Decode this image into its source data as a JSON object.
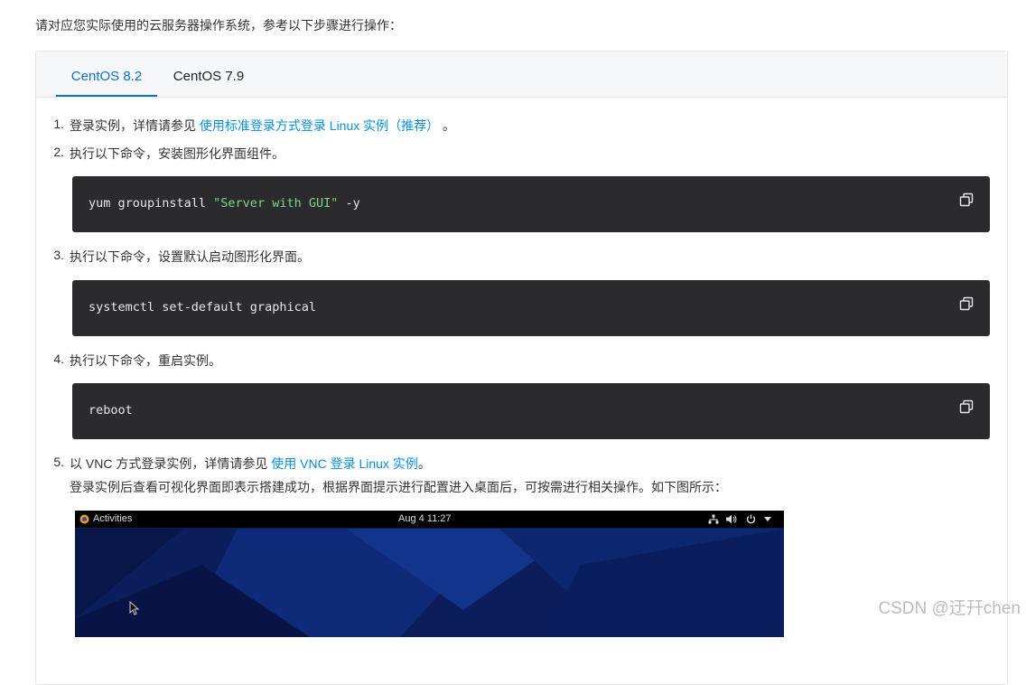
{
  "intro": "请对应您实际使用的云服务器操作系统，参考以下步骤进行操作：",
  "tabs": [
    {
      "label": "CentOS 8.2",
      "active": true
    },
    {
      "label": "CentOS 7.9",
      "active": false
    }
  ],
  "steps": {
    "s1": {
      "num": "1.",
      "pre": "登录实例，详情请参见 ",
      "link": "使用标准登录方式登录 Linux 实例（推荐）",
      "post": " 。"
    },
    "s2": {
      "num": "2.",
      "text": "执行以下命令，安装图形化界面组件。"
    },
    "s3": {
      "num": "3.",
      "text": "执行以下命令，设置默认启动图形化界面。"
    },
    "s4": {
      "num": "4.",
      "text": "执行以下命令，重启实例。"
    },
    "s5": {
      "num": "5.",
      "pre": "以 VNC 方式登录实例，详情请参见 ",
      "link": "使用 VNC 登录 Linux 实例",
      "post": "。",
      "note": "登录实例后查看可视化界面即表示搭建成功，根据界面提示进行配置进入桌面后，可按需进行相关操作。如下图所示："
    }
  },
  "code": {
    "c1": {
      "cmd": "yum groupinstall ",
      "arg": "\"Server with GUI\"",
      "flag": " -y"
    },
    "c2": {
      "cmd": "systemctl set-default graphical"
    },
    "c3": {
      "cmd": "reboot"
    }
  },
  "desktop": {
    "activities": "Activities",
    "clock": "Aug 4  11:27"
  },
  "watermark": "CSDN @迂幵chen",
  "colors": {
    "accent": "#0a71d6",
    "link": "#0a8fe0",
    "code_bg": "#2b2b2e",
    "string": "#7fd58a",
    "keyword": "#6c9ef8"
  }
}
